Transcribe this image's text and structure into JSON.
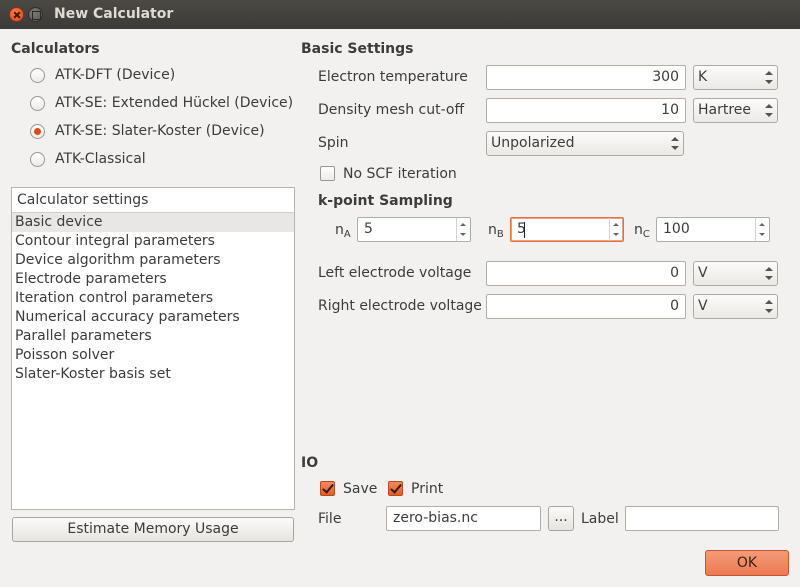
{
  "window": {
    "title": "New Calculator"
  },
  "calculators": {
    "heading": "Calculators",
    "options": [
      {
        "label": "ATK-DFT (Device)",
        "selected": false
      },
      {
        "label": "ATK-SE: Extended Hückel (Device)",
        "selected": false
      },
      {
        "label": "ATK-SE: Slater-Koster (Device)",
        "selected": true
      },
      {
        "label": "ATK-Classical",
        "selected": false
      }
    ]
  },
  "settings_list": {
    "header": "Calculator settings",
    "items": [
      "Basic device",
      "Contour integral parameters",
      "Device algorithm parameters",
      "Electrode parameters",
      "Iteration control parameters",
      "Numerical accuracy parameters",
      "Parallel parameters",
      "Poisson solver",
      "Slater-Koster basis set"
    ],
    "selected_index": 0
  },
  "estimate_button": "Estimate Memory Usage",
  "basic": {
    "heading": "Basic Settings",
    "electron_temperature": {
      "label": "Electron temperature",
      "value": "300",
      "unit": "K"
    },
    "density_mesh": {
      "label": "Density mesh cut-off",
      "value": "10",
      "unit": "Hartree"
    },
    "spin": {
      "label": "Spin",
      "value": "Unpolarized"
    },
    "no_scf": {
      "label": "No SCF iteration",
      "checked": false
    },
    "kpoint": {
      "heading": "k-point Sampling",
      "na": {
        "label": "n",
        "sub": "A",
        "value": "5"
      },
      "nb": {
        "label": "n",
        "sub": "B",
        "value": "5"
      },
      "nc": {
        "label": "n",
        "sub": "C",
        "value": "100"
      }
    },
    "left_voltage": {
      "label": "Left electrode voltage",
      "value": "0",
      "unit": "V"
    },
    "right_voltage": {
      "label": "Right electrode voltage",
      "value": "0",
      "unit": "V"
    }
  },
  "io": {
    "heading": "IO",
    "save": {
      "label": "Save",
      "checked": true
    },
    "print": {
      "label": "Print",
      "checked": true
    },
    "file_label": "File",
    "file_value": "zero-bias.nc",
    "browse_label": "...",
    "label_label": "Label",
    "label_value": ""
  },
  "ok_button": "OK",
  "colors": {
    "accent": "#df4a16",
    "ok_button": "#ec7a52",
    "titlebar": "#3c3b37"
  }
}
